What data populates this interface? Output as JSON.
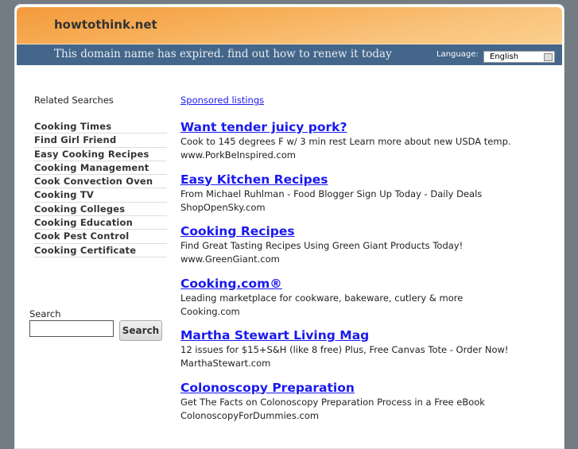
{
  "header": {
    "site": "howtothink.net",
    "message": "This domain name has expired. find out how to renew it today",
    "language_label": "Language:",
    "language_value": "English"
  },
  "sidebar": {
    "title": "Related Searches",
    "items": [
      "Cooking Times",
      "Find Girl Friend",
      "Easy Cooking Recipes",
      "Cooking Management",
      "Cook Convection Oven",
      "Cooking TV",
      "Cooking Colleges",
      "Cooking Education",
      "Cook Pest Control",
      "Cooking Certificate"
    ],
    "search_label": "Search",
    "search_value": "",
    "search_button": "Search"
  },
  "main": {
    "sponsored": "Sponsored listings",
    "ads": [
      {
        "title": "Want tender juicy pork?",
        "desc": "Cook to 145 degrees F w/ 3 min rest Learn more about new USDA temp.",
        "url": "www.PorkBeInspired.com"
      },
      {
        "title": "Easy Kitchen Recipes",
        "desc": "From Michael Ruhlman - Food Blogger Sign Up Today - Daily Deals",
        "url": "ShopOpenSky.com"
      },
      {
        "title": "Cooking Recipes",
        "desc": "Find Great Tasting Recipes Using Green Giant Products Today!",
        "url": "www.GreenGiant.com"
      },
      {
        "title": "Cooking.com®",
        "desc": "Leading marketplace for cookware, bakeware, cutlery & more",
        "url": "Cooking.com"
      },
      {
        "title": "Martha Stewart Living Mag",
        "desc": "12 issues for $15+S&H (like 8 free) Plus, Free Canvas Tote - Order Now!",
        "url": "MarthaStewart.com"
      },
      {
        "title": "Colonoscopy Preparation",
        "desc": "Get The Facts on Colonoscopy Preparation Process in a Free eBook",
        "url": "ColonoscopyForDummies.com"
      }
    ]
  }
}
